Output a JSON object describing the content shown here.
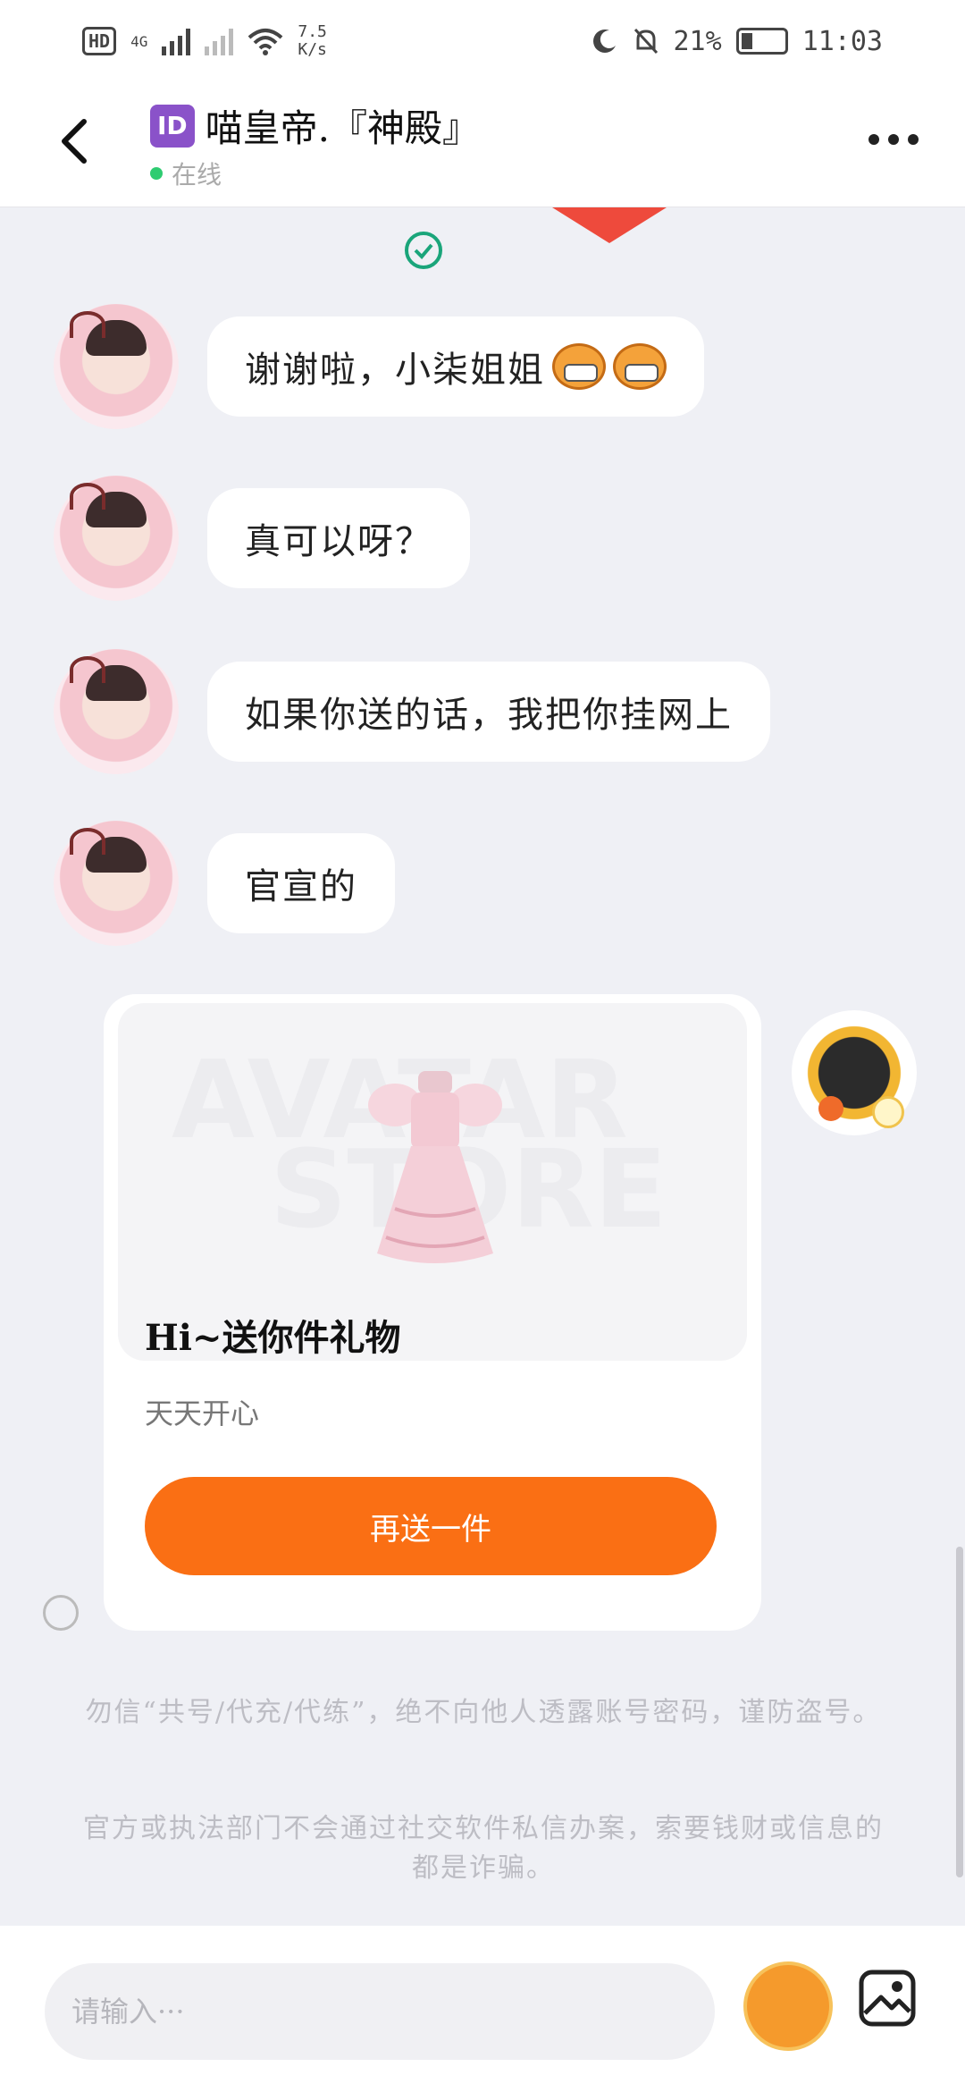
{
  "status_bar": {
    "hd": "HD",
    "network": "4G",
    "speed_value": "7.5",
    "speed_unit": "K/s",
    "battery_percent": "21%",
    "time": "11:03"
  },
  "header": {
    "id_badge": "ID",
    "title": "喵皇帝.『神殿』",
    "status": "在线"
  },
  "messages": [
    {
      "text": "谢谢啦，小柒姐姐"
    },
    {
      "text": "真可以呀？"
    },
    {
      "text": "如果你送的话，我把你挂网上"
    },
    {
      "text": "官宣的"
    }
  ],
  "gift_card": {
    "watermark_top": "AVATAR",
    "watermark_bottom": "STORE",
    "title": "Hi~送你件礼物",
    "subtitle": "天天开心",
    "button": "再送一件"
  },
  "notices": {
    "line1": "勿信“共号/代充/代练”，绝不向他人透露账号密码，谨防盗号。",
    "line2": "官方或执法部门不会通过社交软件私信办案，索要钱财或信息的都是诈骗。"
  },
  "input": {
    "placeholder": "请输入···"
  },
  "colors": {
    "accent": "#fa6f14",
    "online": "#2ecc71",
    "id_badge": "#8a52c9"
  }
}
